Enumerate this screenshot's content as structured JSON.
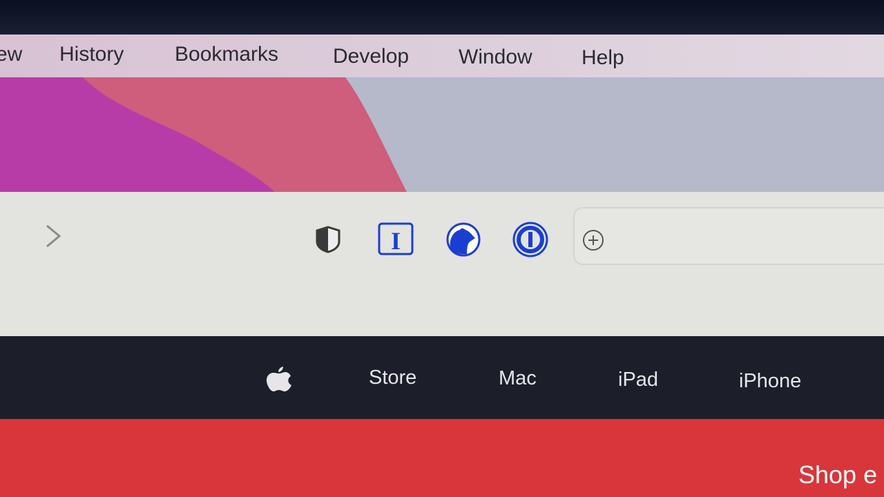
{
  "menubar": {
    "items": [
      "ew",
      "History",
      "Bookmarks",
      "Develop",
      "Window",
      "Help"
    ]
  },
  "toolbar": {
    "icons": [
      "forward-chevron-icon",
      "privacy-shield-icon",
      "instapaper-icon",
      "bear-icon",
      "1password-icon",
      "add-tab-icon"
    ]
  },
  "site_nav": {
    "items": [
      "Store",
      "Mac",
      "iPad",
      "iPhone"
    ]
  },
  "banner": {
    "text": "Shop e"
  },
  "colors": {
    "accent_blue": "#1a3fd0",
    "nav_bg": "#1c1f2a",
    "banner_red": "#d8363a"
  }
}
